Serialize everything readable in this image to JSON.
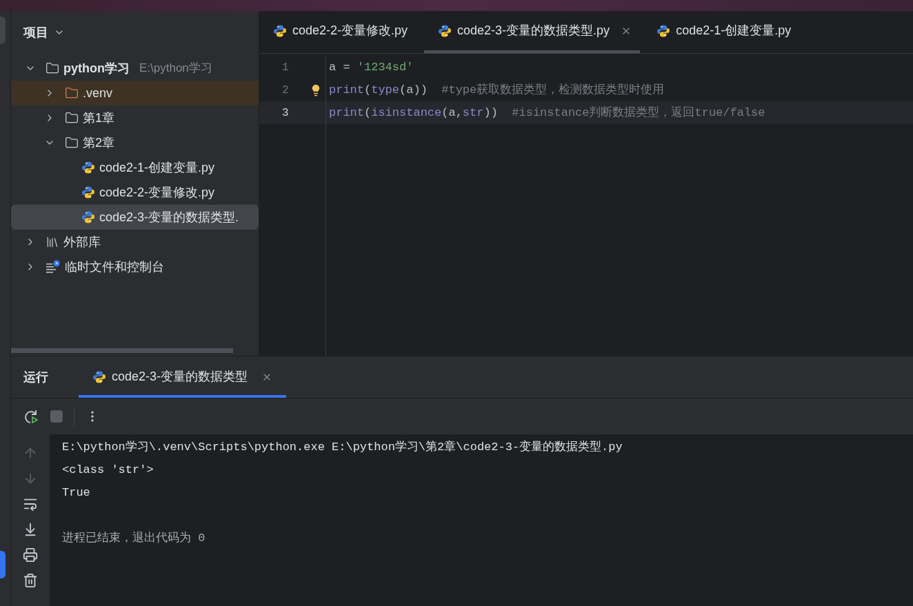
{
  "project_panel": {
    "title": "项目",
    "tree": [
      {
        "kind": "folder",
        "label": "python学习",
        "path": "E:\\python学习",
        "expanded": true,
        "selected": false,
        "children": [
          {
            "kind": "venv",
            "label": ".venv",
            "expanded": false,
            "selected": false
          },
          {
            "kind": "folder",
            "label": "第1章",
            "expanded": false,
            "selected": false
          },
          {
            "kind": "folder",
            "label": "第2章",
            "expanded": true,
            "selected": false,
            "children": [
              {
                "kind": "python",
                "label": "code2-1-创建变量.py",
                "selected": false
              },
              {
                "kind": "python",
                "label": "code2-2-变量修改.py",
                "selected": false
              },
              {
                "kind": "python",
                "label": "code2-3-变量的数据类型.",
                "selected": true
              }
            ]
          }
        ]
      },
      {
        "kind": "library",
        "label": "外部库",
        "expanded": false,
        "selected": false
      },
      {
        "kind": "scratch",
        "label": "临时文件和控制台",
        "expanded": false,
        "selected": false
      }
    ]
  },
  "editor": {
    "tabs": [
      {
        "label": "code2-2-变量修改.py",
        "selected": false
      },
      {
        "label": "code2-3-变量的数据类型.py",
        "selected": true
      },
      {
        "label": "code2-1-创建变量.py",
        "selected": false
      }
    ],
    "lines": [
      {
        "number": "1",
        "current": false,
        "tokens": [
          {
            "kind": "plain",
            "text": "a = "
          },
          {
            "kind": "string",
            "text": "'1234sd'"
          }
        ]
      },
      {
        "number": "2",
        "current": false,
        "tokens": [
          {
            "kind": "func",
            "text": "print"
          },
          {
            "kind": "plain",
            "text": "("
          },
          {
            "kind": "func",
            "text": "type"
          },
          {
            "kind": "plain",
            "text": "(a))  "
          },
          {
            "kind": "comment",
            "text": "#type获取数据类型，检测数据类型时使用"
          }
        ]
      },
      {
        "number": "3",
        "current": true,
        "tokens": [
          {
            "kind": "func",
            "text": "print"
          },
          {
            "kind": "plain",
            "text": "("
          },
          {
            "kind": "func",
            "text": "isinstance"
          },
          {
            "kind": "plain",
            "text": "(a,"
          },
          {
            "kind": "func",
            "text": "str"
          },
          {
            "kind": "plain",
            "text": "))  "
          },
          {
            "kind": "comment",
            "text": "#isinstance判断数据类型，返回true/false"
          }
        ]
      }
    ]
  },
  "run_panel": {
    "title": "运行",
    "tabs": [
      {
        "label": "code2-3-变量的数据类型",
        "selected": true
      }
    ],
    "output": [
      {
        "kind": "output",
        "text": "E:\\python学习\\.venv\\Scripts\\python.exe E:\\python学习\\第2章\\code2-3-变量的数据类型.py"
      },
      {
        "kind": "output",
        "text": "<class 'str'>"
      },
      {
        "kind": "output",
        "text": "True"
      },
      {
        "kind": "blank"
      },
      {
        "kind": "exit",
        "text": "进程已结束，退出代码为 0"
      }
    ]
  }
}
